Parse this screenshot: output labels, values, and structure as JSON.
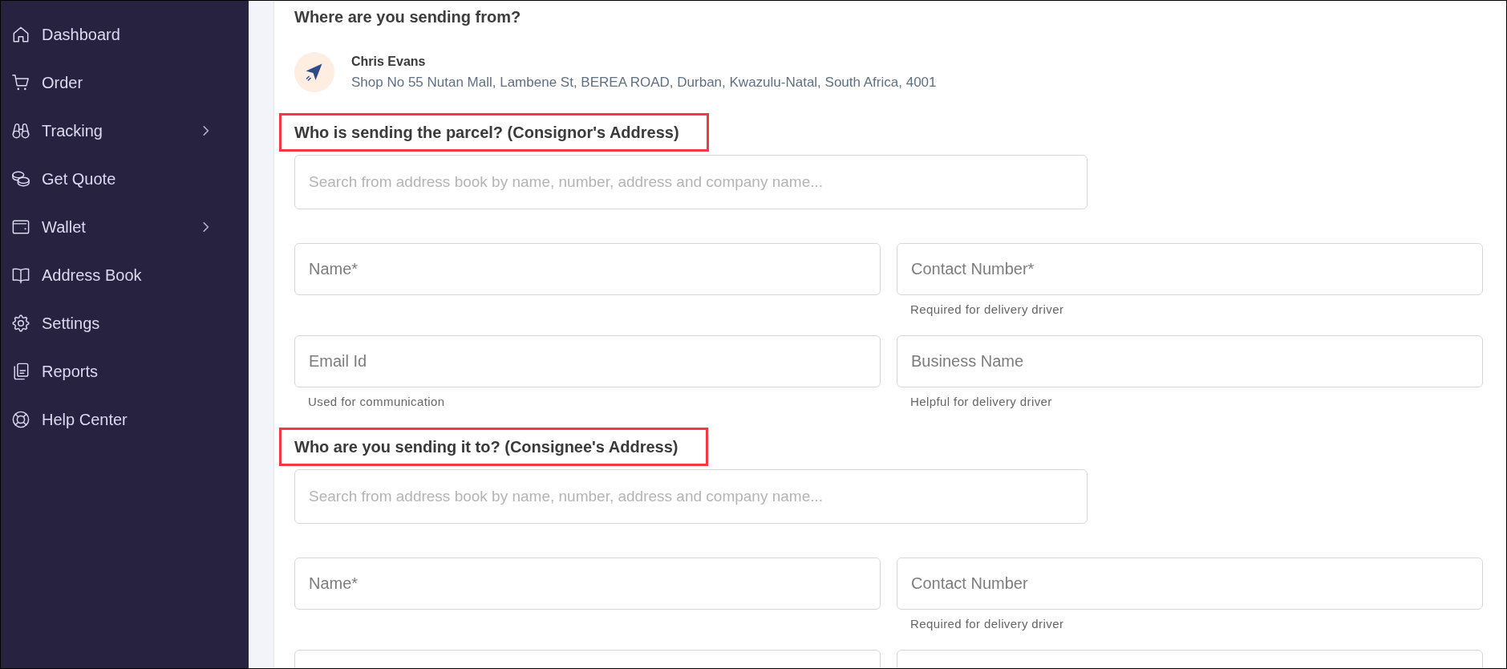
{
  "sidebar": {
    "items": [
      {
        "label": "Dashboard",
        "has_submenu": false,
        "selected": false
      },
      {
        "label": "Order",
        "has_submenu": false,
        "selected": false
      },
      {
        "label": "Tracking",
        "has_submenu": true,
        "selected": false
      },
      {
        "label": "Get Quote",
        "has_submenu": false,
        "selected": false
      },
      {
        "label": "Wallet",
        "has_submenu": true,
        "selected": false
      },
      {
        "label": "Address Book",
        "has_submenu": false,
        "selected": false
      },
      {
        "label": "Settings",
        "has_submenu": false,
        "selected": false
      },
      {
        "label": "Reports",
        "has_submenu": false,
        "selected": false
      },
      {
        "label": "Help Center",
        "has_submenu": false,
        "selected": false
      }
    ]
  },
  "sender": {
    "heading": "Where are you sending from?",
    "name": "Chris Evans",
    "address": "Shop No 55 Nutan Mall, Lambene St, BEREA ROAD, Durban, Kwazulu-Natal, South Africa, 4001"
  },
  "sections": [
    {
      "heading": "Who is sending the parcel? (Consignor's Address)",
      "highlighted": true,
      "search": {
        "placeholder": "Search from address book by name, number, address and company name..."
      },
      "rows": [
        {
          "fields": [
            {
              "kind": "text",
              "placeholder": "Name*"
            },
            {
              "kind": "text",
              "placeholder": "Contact Number*",
              "hint": "Required for delivery driver"
            }
          ]
        },
        {
          "fields": [
            {
              "kind": "text",
              "placeholder": "Email Id",
              "hint": "Used for communication"
            },
            {
              "kind": "text",
              "placeholder": "Business Name",
              "hint": "Helpful for delivery driver"
            }
          ]
        }
      ]
    },
    {
      "heading": "Who are you sending it to? (Consignee's Address)",
      "highlighted": true,
      "search": {
        "placeholder": "Search from address book by name, number, address and company name..."
      },
      "rows": [
        {
          "fields": [
            {
              "kind": "text",
              "placeholder": "Name*"
            },
            {
              "kind": "text",
              "placeholder": "Contact Number",
              "hint": "Required for delivery driver"
            }
          ]
        },
        {
          "fields": [
            {
              "kind": "text"
            },
            {
              "kind": "text"
            }
          ]
        }
      ]
    }
  ]
}
